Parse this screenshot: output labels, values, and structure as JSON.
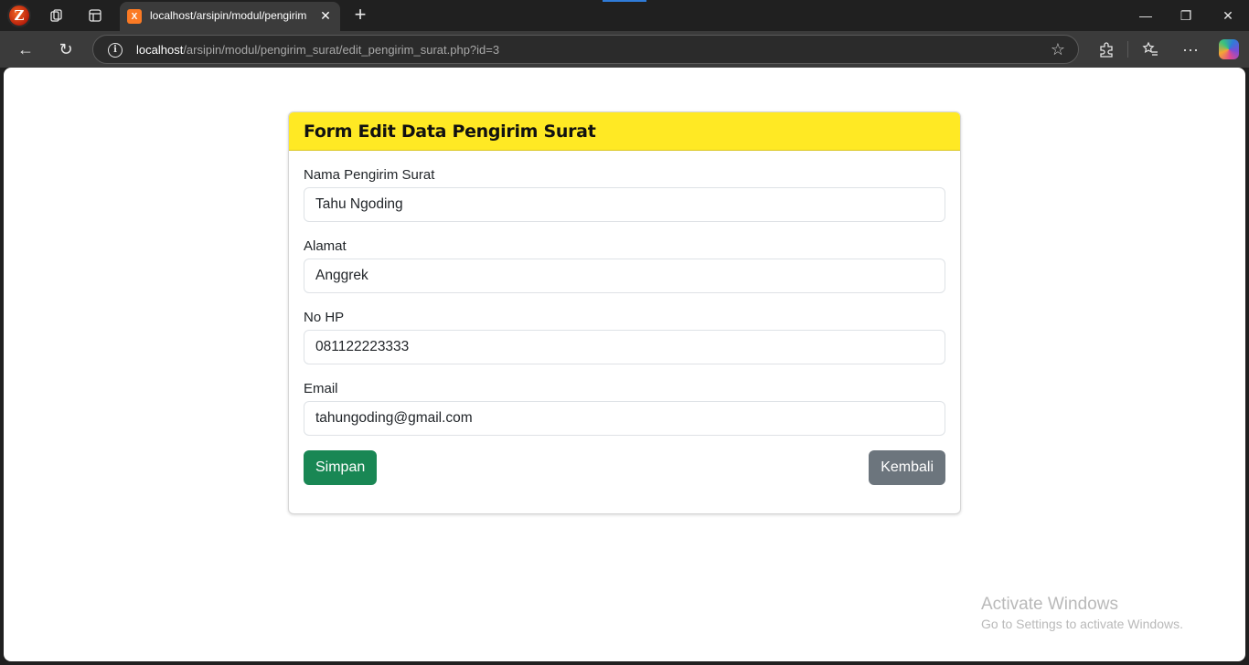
{
  "browser": {
    "tab_title": "localhost/arsipin/modul/pengirim",
    "tab_favicon": "X",
    "url_host": "localhost",
    "url_path": "/arsipin/modul/pengirim_surat/edit_pengirim_surat.php?id=3",
    "icons": {
      "app": "zend-logo",
      "workspaces": "workspaces-icon",
      "tab_actions": "tab-actions-icon",
      "new_tab": "+",
      "back": "←",
      "refresh": "↻",
      "info": "i",
      "favorite": "☆",
      "extensions": "⧉",
      "favorites": "☆≡",
      "more": "···"
    },
    "window_controls": {
      "minimize": "—",
      "restore": "❐",
      "close": "✕"
    }
  },
  "form": {
    "title": "Form Edit Data Pengirim Surat",
    "fields": [
      {
        "label": "Nama Pengirim Surat",
        "value": "Tahu Ngoding"
      },
      {
        "label": "Alamat",
        "value": "Anggrek"
      },
      {
        "label": "No HP",
        "value": "081122223333"
      },
      {
        "label": "Email",
        "value": "tahungoding@gmail.com"
      }
    ],
    "save_label": "Simpan",
    "back_label": "Kembali"
  },
  "watermark": {
    "title": "Activate Windows",
    "subtitle": "Go to Settings to activate Windows."
  },
  "colors": {
    "header_bg": "#ffe924",
    "save_bg": "#198754",
    "back_bg": "#6c757d"
  }
}
